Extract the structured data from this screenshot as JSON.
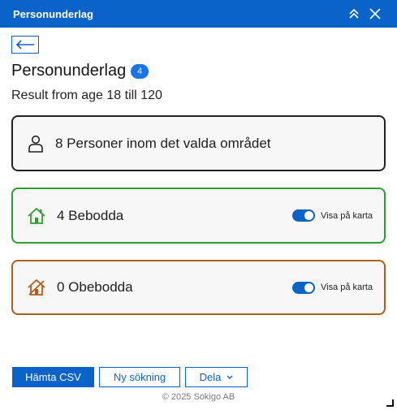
{
  "window": {
    "title": "Personunderlag"
  },
  "heading": {
    "title": "Personunderlag",
    "badge_count": "4"
  },
  "subtitle": "Result from age 18 till 120",
  "cards": {
    "total": {
      "label": "8 Personer inom det valda området",
      "icon": "person-icon"
    },
    "inhabited": {
      "label": "4 Bebodda",
      "icon": "house-icon",
      "toggle_label": "Visa på karta",
      "toggle_on": true,
      "color": "#2e9f2e"
    },
    "empty": {
      "label": "0 Obebodda",
      "icon": "house-crossed-icon",
      "toggle_label": "Visa på karta",
      "toggle_on": true,
      "color": "#b05f1a"
    }
  },
  "buttons": {
    "csv": "Hämta CSV",
    "new_search": "Ny sökning",
    "share": "Dela"
  },
  "footer": "© 2025 Sokigo AB",
  "colors": {
    "accent": "#0a63c9",
    "badge": "#1a73e8"
  }
}
